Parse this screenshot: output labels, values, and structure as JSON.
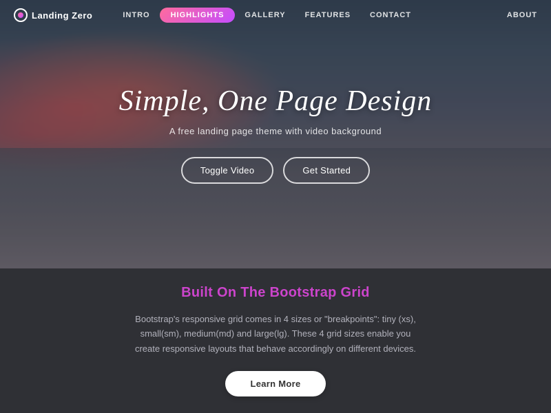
{
  "nav": {
    "brand": "Landing Zero",
    "links": [
      {
        "label": "INTRO",
        "active": false
      },
      {
        "label": "HIGHLIGHTS",
        "active": true
      },
      {
        "label": "GALLERY",
        "active": false
      },
      {
        "label": "FEATURES",
        "active": false
      },
      {
        "label": "CONTACT",
        "active": false
      }
    ],
    "right_link": "ABOUT"
  },
  "hero": {
    "title": "Simple, One Page Design",
    "subtitle": "A free landing page theme with video background",
    "button_toggle": "Toggle Video",
    "button_started": "Get Started"
  },
  "content": {
    "title": "Built On The Bootstrap Grid",
    "body": "Bootstrap's responsive grid comes in 4 sizes or \"breakpoints\": tiny (xs), small(sm), medium(md) and large(lg). These 4 grid sizes enable you create responsive layouts that behave accordingly on different devices.",
    "button_learn": "Learn More"
  }
}
